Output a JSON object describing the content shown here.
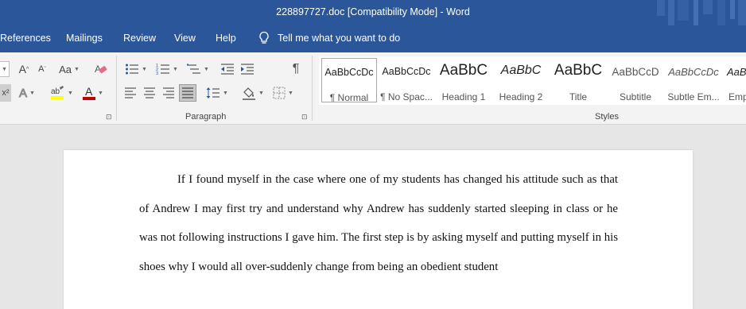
{
  "window": {
    "title": "228897727.doc [Compatibility Mode]  -  Word"
  },
  "tabs": [
    {
      "label": "References"
    },
    {
      "label": "Mailings"
    },
    {
      "label": "Review"
    },
    {
      "label": "View"
    },
    {
      "label": "Help"
    }
  ],
  "tellme": {
    "text": "Tell me what you want to do"
  },
  "ribbon": {
    "paragraph_label": "Paragraph",
    "styles_label": "Styles",
    "font": {
      "grow_label": "A",
      "shrink_label": "A",
      "case_label": "Aa",
      "texteffect_label": "A",
      "fontcolor_label": "A",
      "highlight_color": "#ffff00",
      "fontcolor_color": "#c00000"
    },
    "styles": [
      {
        "preview": "AaBbCcDc",
        "name": "¶ Normal"
      },
      {
        "preview": "AaBbCcDc",
        "name": "¶ No Spac..."
      },
      {
        "preview": "AaBbC",
        "name": "Heading 1"
      },
      {
        "preview": "AaBbC",
        "name": "Heading 2"
      },
      {
        "preview": "AaBbC",
        "name": "Title"
      },
      {
        "preview": "AaBbCcD",
        "name": "Subtitle"
      },
      {
        "preview": "AaBbCcDc",
        "name": "Subtle Em..."
      },
      {
        "preview": "AaB",
        "name": "Emp"
      }
    ]
  },
  "document": {
    "paragraph": "If I found myself in the case where one of my students has changed his attitude such as that of Andrew I may first try and understand why Andrew has suddenly started sleeping in class or he was not following instructions I gave him. The first step is by asking myself and putting myself in his shoes why I would all over-suddenly change from being an obedient student"
  },
  "colors": {
    "accent": "#2b579a",
    "ribbon_bg": "#f3f3f3",
    "canvas_bg": "#e6e6e6"
  }
}
